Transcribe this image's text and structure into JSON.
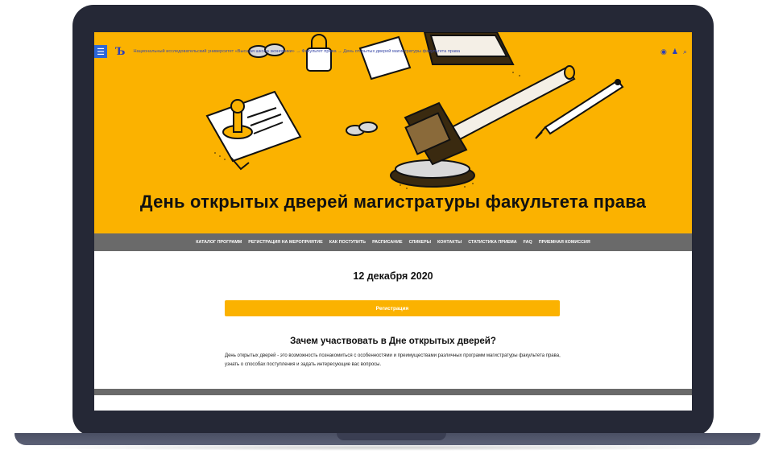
{
  "topbar": {
    "breadcrumb": "Национальный исследовательский университет «Высшая школа экономики» → Факультет права → День открытых дверей магистратуры факультета права",
    "logo": "Ъ"
  },
  "hero": {
    "title": "День открытых дверей магистратуры факультета права"
  },
  "nav": {
    "items": [
      "КАТАЛОГ ПРОГРАММ",
      "РЕГИСТРАЦИЯ НА МЕРОПРИЯТИЕ",
      "КАК ПОСТУПИТЬ",
      "РАСПИСАНИЕ",
      "СПИКЕРЫ",
      "КОНТАКТЫ",
      "СТАТИСТИКА ПРИЕМА",
      "FAQ",
      "ПРИЕМНАЯ КОМИССИЯ"
    ]
  },
  "main": {
    "date": "12 декабря 2020",
    "register_label": "Регистрация",
    "why_title": "Зачем участвовать в Дне открытых дверей?",
    "why_text": "День открытых дверей - это возможность познакомиться с особенностями и преимуществами различных программ магистратуры факультета права, узнать о способах поступления и задать интересующие вас вопросы."
  },
  "colors": {
    "accent": "#fbb200",
    "nav_bg": "#6a6a6a",
    "menu_blue": "#2c66d6"
  },
  "icons": [
    "menu-icon",
    "eye-icon",
    "user-icon",
    "search-icon"
  ]
}
